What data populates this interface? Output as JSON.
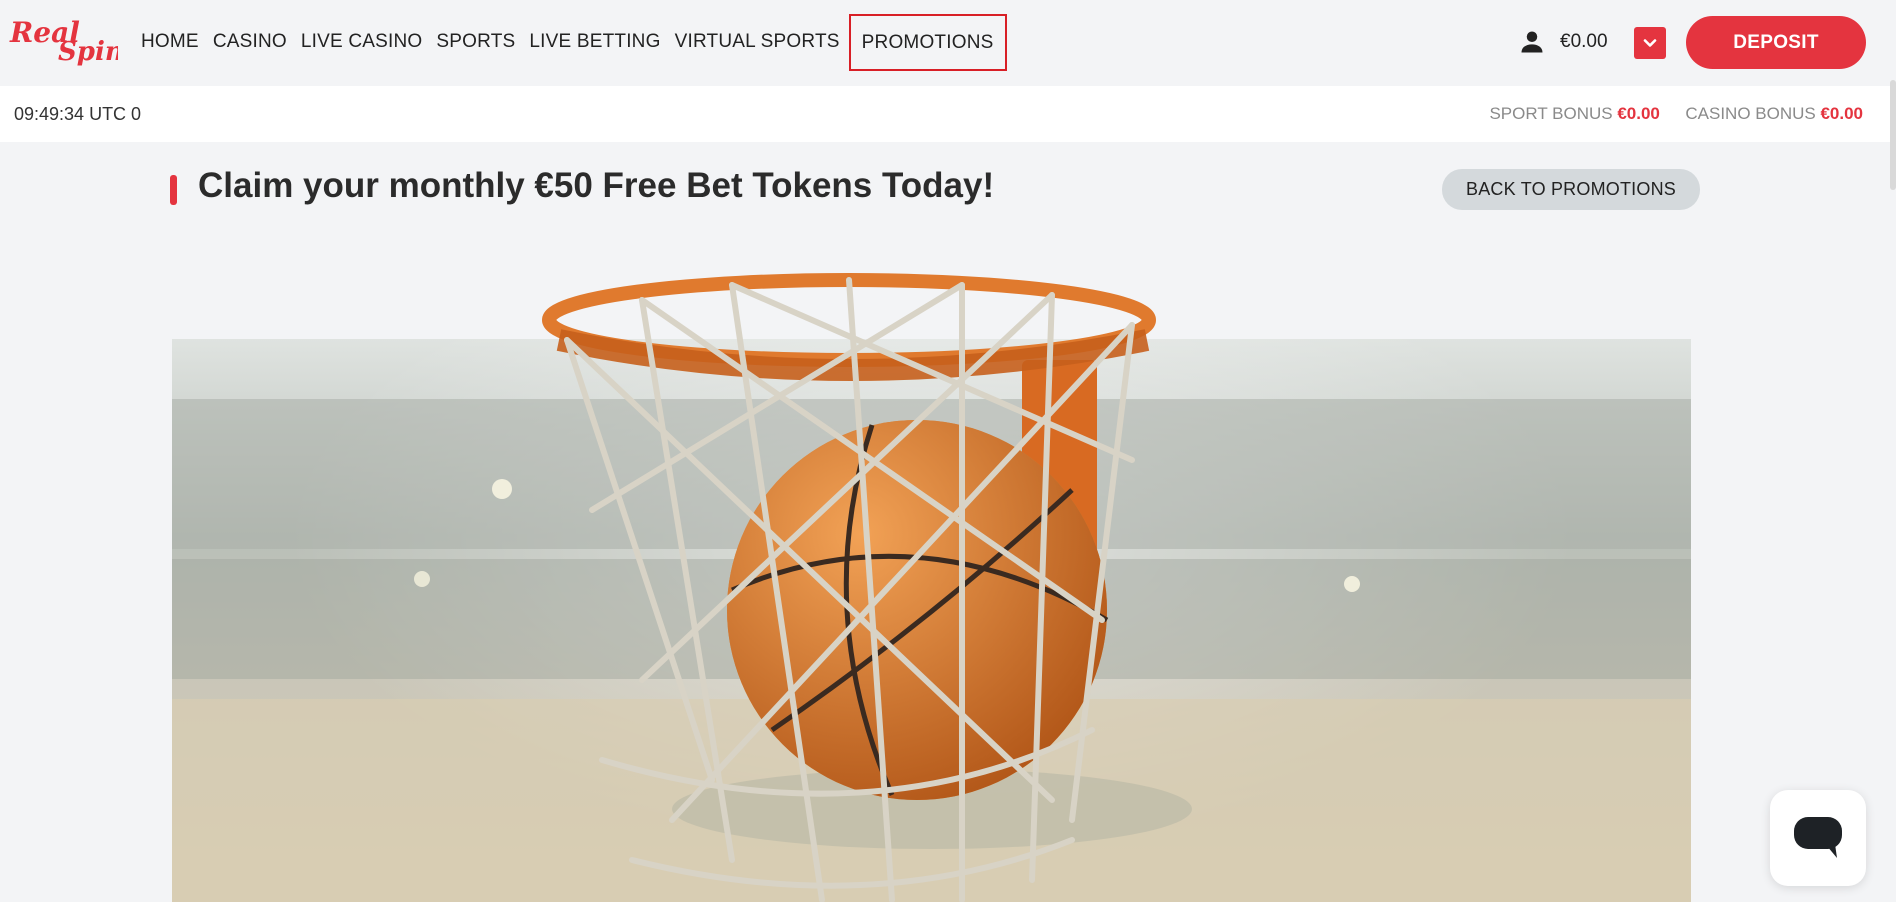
{
  "brand": {
    "logo_text": "RealSpin",
    "accent": "#e4343f"
  },
  "nav": {
    "items": [
      {
        "label": "HOME"
      },
      {
        "label": "CASINO"
      },
      {
        "label": "LIVE CASINO"
      },
      {
        "label": "SPORTS"
      },
      {
        "label": "LIVE BETTING"
      },
      {
        "label": "VIRTUAL SPORTS"
      },
      {
        "label": "PROMOTIONS",
        "active": true
      }
    ]
  },
  "account": {
    "balance": "€0.00",
    "deposit_label": "DEPOSIT",
    "user_icon": "user-icon",
    "dropdown_icon": "chevron-down-icon"
  },
  "subbar": {
    "clock": "09:49:34 UTC 0",
    "sport_bonus_label": "SPORT BONUS",
    "sport_bonus_value": "€0.00",
    "casino_bonus_label": "CASINO BONUS",
    "casino_bonus_value": "€0.00"
  },
  "promo": {
    "title": "Claim your monthly €50 Free Bet Tokens Today!",
    "back_label": "BACK TO PROMOTIONS",
    "banner_image": "basketball-hoop-banner"
  },
  "chat": {
    "icon": "chat-bubble-icon"
  }
}
